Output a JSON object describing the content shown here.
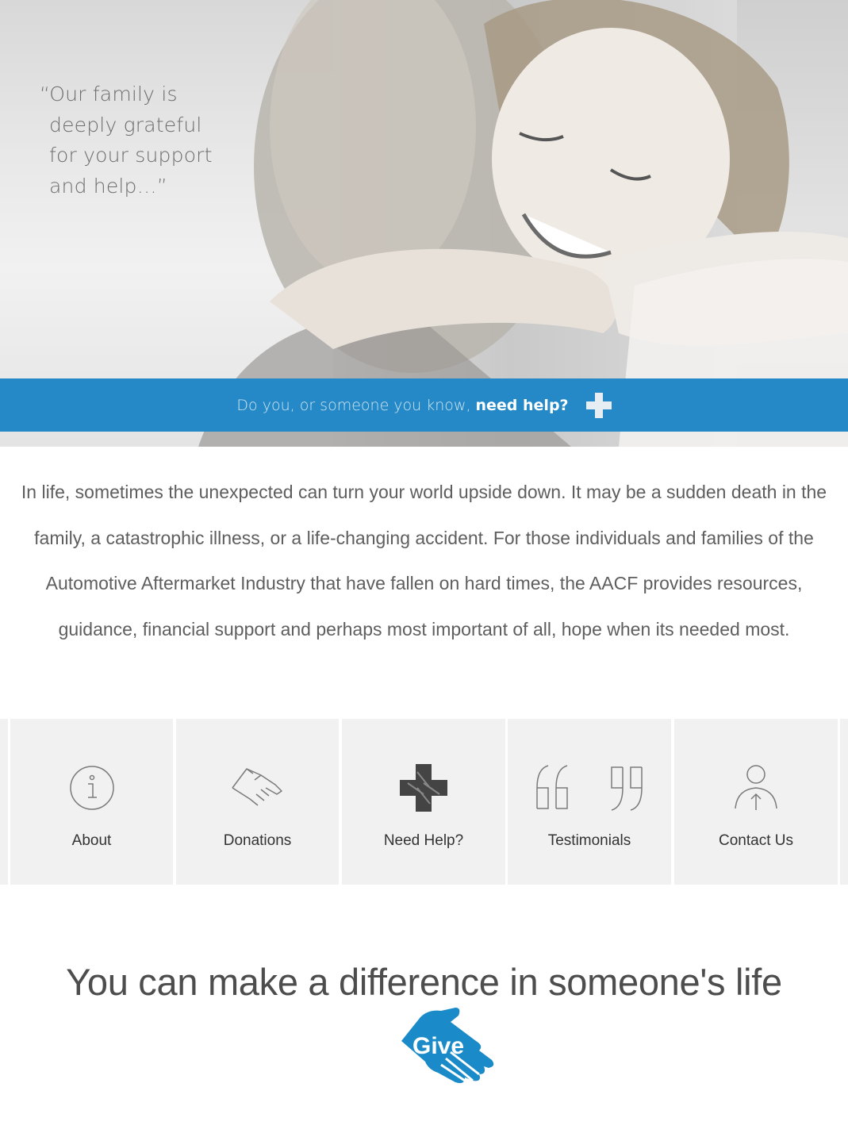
{
  "hero": {
    "quote_lines": [
      "“Our family is",
      "deeply grateful",
      "for your support",
      "and help…”"
    ],
    "help_bar": {
      "lead": "Do you, or someone you know,",
      "strong": "need help?",
      "icon": "plus-icon"
    }
  },
  "intro": {
    "text": "In life, sometimes the unexpected can turn your world upside down. It may be a sudden death in the family, a catastrophic illness, or a life-changing accident. For those individuals and families of the Automotive Aftermarket Industry that have fallen on hard times, the AACF provides resources, guidance, financial support and perhaps most important of all, hope when its needed most."
  },
  "nav": {
    "items": [
      {
        "label": "About",
        "icon": "info-icon"
      },
      {
        "label": "Donations",
        "icon": "handshake-icon"
      },
      {
        "label": "Need Help?",
        "icon": "medical-cross-icon"
      },
      {
        "label": "Testimonials",
        "icon": "quote-marks-icon"
      },
      {
        "label": "Contact Us",
        "icon": "person-icon"
      }
    ]
  },
  "cta": {
    "heading": "You can make a difference in someone's life",
    "give_label": "Give",
    "give_color": "#1a8ac8"
  },
  "colors": {
    "accent": "#2589c7",
    "tile_bg": "#f1f1f2",
    "text": "#5e5e5e"
  }
}
